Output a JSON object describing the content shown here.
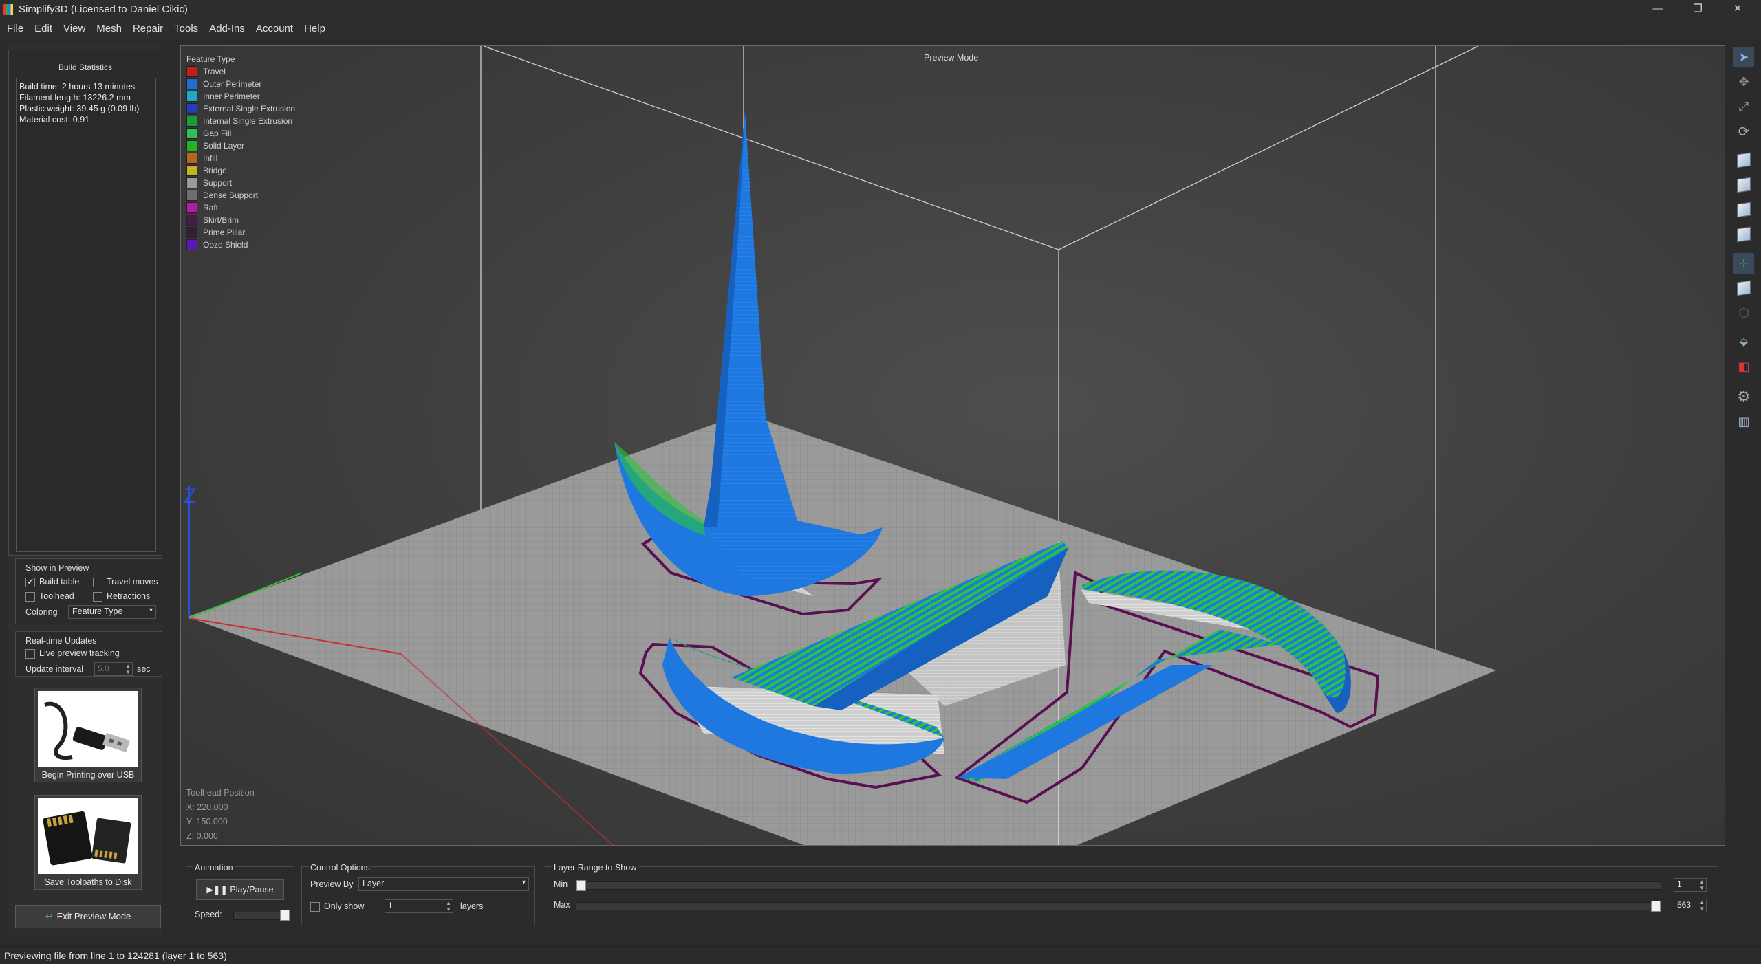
{
  "window": {
    "title": "Simplify3D (Licensed to Daniel Cikic)",
    "controls": {
      "minimize": "—",
      "restore": "❐",
      "close": "✕"
    }
  },
  "menu": [
    "File",
    "Edit",
    "View",
    "Mesh",
    "Repair",
    "Tools",
    "Add-Ins",
    "Account",
    "Help"
  ],
  "build_stats": {
    "title": "Build Statistics",
    "lines": [
      "Build time: 2 hours 13 minutes",
      "Filament length: 13226.2 mm",
      "Plastic weight: 39.45 g (0.09 lb)",
      "Material cost: 0.91"
    ]
  },
  "show_in_preview": {
    "title": "Show in Preview",
    "build_table": {
      "label": "Build table",
      "checked": true
    },
    "travel_moves": {
      "label": "Travel moves",
      "checked": false
    },
    "toolhead": {
      "label": "Toolhead",
      "checked": false
    },
    "retractions": {
      "label": "Retractions",
      "checked": false
    },
    "coloring_label": "Coloring",
    "coloring_value": "Feature Type"
  },
  "realtime": {
    "title": "Real-time Updates",
    "live_label": "Live preview tracking",
    "live_checked": false,
    "interval_label": "Update interval",
    "interval_value": "5.0",
    "interval_unit": "sec"
  },
  "actions": {
    "usb_label": "Begin Printing over USB",
    "disk_label": "Save Toolpaths to Disk",
    "exit_label": "Exit Preview Mode"
  },
  "viewport": {
    "mode_label": "Preview Mode",
    "legend_title": "Feature Type",
    "legend": [
      {
        "label": "Travel",
        "color": "#c0201f"
      },
      {
        "label": "Outer Perimeter",
        "color": "#1e6fd0"
      },
      {
        "label": "Inner Perimeter",
        "color": "#21a8c8"
      },
      {
        "label": "External Single Extrusion",
        "color": "#1f3fc0"
      },
      {
        "label": "Internal Single Extrusion",
        "color": "#1d9a3a"
      },
      {
        "label": "Gap Fill",
        "color": "#2fbf5c"
      },
      {
        "label": "Solid Layer",
        "color": "#26b126"
      },
      {
        "label": "Infill",
        "color": "#b8641c"
      },
      {
        "label": "Bridge",
        "color": "#c8b21e"
      },
      {
        "label": "Support",
        "color": "#9a9a9a"
      },
      {
        "label": "Dense Support",
        "color": "#6e6e6e"
      },
      {
        "label": "Raft",
        "color": "#b01ab0"
      },
      {
        "label": "Skirt/Brim",
        "color": "#4a1a4a"
      },
      {
        "label": "Prime Pillar",
        "color": "#3a1a3a"
      },
      {
        "label": "Ooze Shield",
        "color": "#5a1ab0"
      }
    ],
    "axis_z_label": "Z",
    "toolhead_title": "Toolhead Position",
    "toolhead_x": "X: 220.000",
    "toolhead_y": "Y: 150.000",
    "toolhead_z": "Z: 0.000"
  },
  "animation": {
    "title": "Animation",
    "play_label": "Play/Pause",
    "speed_label": "Speed:"
  },
  "control_options": {
    "title": "Control Options",
    "preview_by_label": "Preview By",
    "preview_by_value": "Layer",
    "only_show_label": "Only show",
    "only_show_value": "1",
    "only_show_unit": "layers"
  },
  "layer_range": {
    "title": "Layer Range to Show",
    "min_label": "Min",
    "max_label": "Max",
    "min_value": "1",
    "max_value": "563",
    "min_fraction": 0.0,
    "max_fraction": 1.0
  },
  "status": "Previewing file from line 1 to 124281 (layer 1 to 563)"
}
